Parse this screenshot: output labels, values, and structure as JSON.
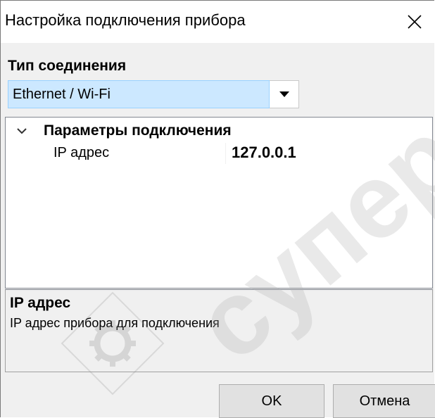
{
  "window": {
    "title": "Настройка подключения прибора",
    "close_icon": "close-icon"
  },
  "connection": {
    "section_label": "Тип соединения",
    "type_value": "Ethernet / Wi-Fi",
    "dropdown_icon": "chevron-down-icon"
  },
  "property_grid": {
    "category": {
      "label": "Параметры подключения",
      "expanded": true,
      "icon": "chevron-down-icon"
    },
    "properties": [
      {
        "name": "IP адрес",
        "value": "127.0.0.1"
      }
    ]
  },
  "help": {
    "title": "IP адрес",
    "description": "IP адрес прибора для подключения"
  },
  "buttons": {
    "ok_label": "OK",
    "cancel_label": "Отмена"
  },
  "watermark": {
    "text": "суперай",
    "color": "#b0b0b0"
  },
  "colors": {
    "selection": "#cce8ff",
    "selection_border": "#99d1ff",
    "dialog_bg": "#f0f0f0"
  }
}
